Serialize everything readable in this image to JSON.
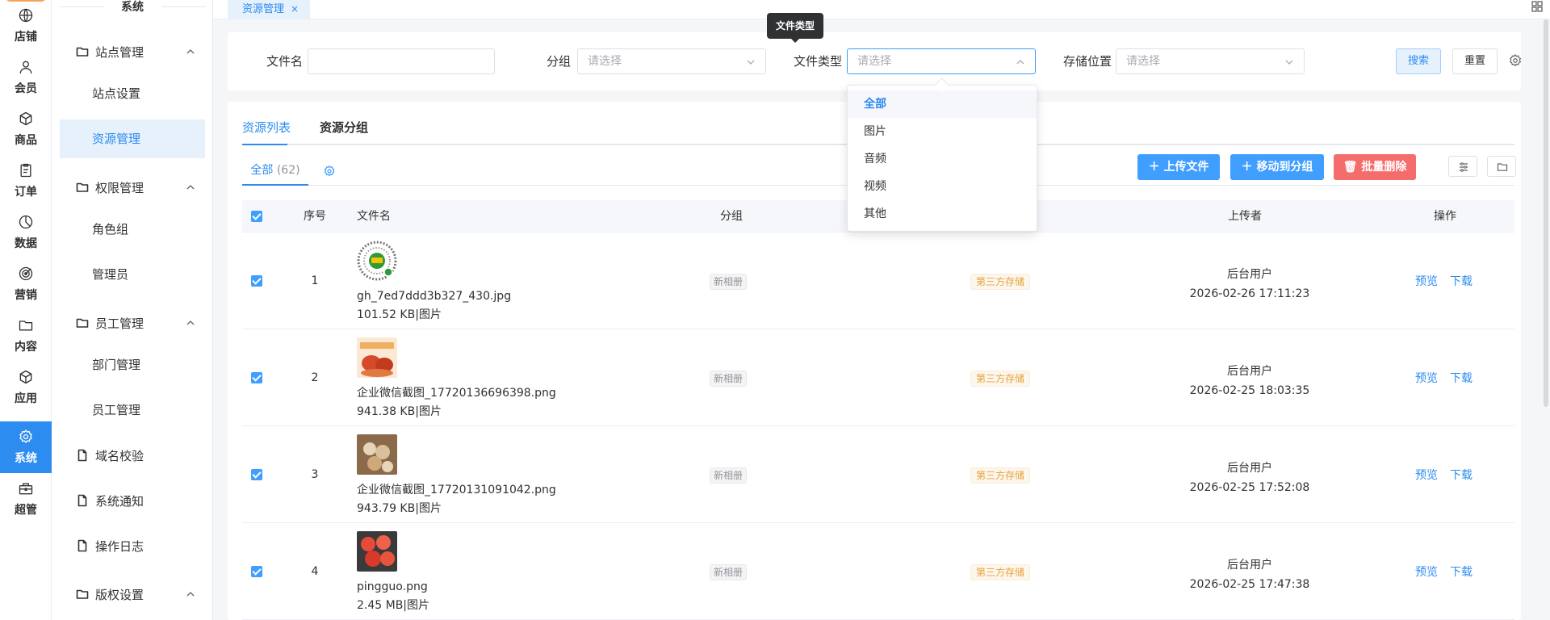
{
  "rail": {
    "items": [
      {
        "label": "店铺",
        "icon": "store-icon"
      },
      {
        "label": "会员",
        "icon": "member-icon"
      },
      {
        "label": "商品",
        "icon": "product-icon"
      },
      {
        "label": "订单",
        "icon": "order-icon"
      },
      {
        "label": "数据",
        "icon": "data-icon"
      },
      {
        "label": "营销",
        "icon": "marketing-icon"
      },
      {
        "label": "内容",
        "icon": "content-icon"
      },
      {
        "label": "应用",
        "icon": "app-icon"
      },
      {
        "label": "系统",
        "icon": "system-gear-icon",
        "active": true
      },
      {
        "label": "超管",
        "icon": "admin-icon"
      }
    ]
  },
  "menu": {
    "title": "系统",
    "groups": [
      {
        "label": "站点管理"
      },
      {
        "label": "权限管理"
      },
      {
        "label": "员工管理"
      },
      {
        "label": "域名校验"
      },
      {
        "label": "系统通知"
      },
      {
        "label": "操作日志"
      },
      {
        "label": "版权设置"
      }
    ],
    "subs": [
      {
        "label": "站点设置"
      },
      {
        "label": "资源管理",
        "active": true
      },
      {
        "label": "角色组"
      },
      {
        "label": "管理员"
      },
      {
        "label": "部门管理"
      },
      {
        "label": "员工管理"
      }
    ]
  },
  "tabbar": {
    "tab_label": "资源管理",
    "close": "×"
  },
  "filter": {
    "filename_label": "文件名",
    "filename_value": "",
    "group_label": "分组",
    "group_placeholder": "请选择",
    "filetype_label": "文件类型",
    "filetype_placeholder": "请选择",
    "storage_label": "存储位置",
    "storage_placeholder": "请选择",
    "search_btn": "搜索",
    "reset_btn": "重置"
  },
  "tooltip": "文件类型",
  "dropdown": {
    "options": [
      "全部",
      "图片",
      "音频",
      "视频",
      "其他"
    ],
    "selected": "全部"
  },
  "main": {
    "tabs": [
      "资源列表",
      "资源分组"
    ],
    "subtab_label": "全部",
    "subtab_count": "(62)",
    "upload_btn": "上传文件",
    "move_btn": "移动到分组",
    "delete_btn": "批量删除"
  },
  "table": {
    "headers": {
      "index": "序号",
      "filename": "文件名",
      "group": "分组",
      "uploader": "上传者",
      "action": "操作"
    },
    "rows": [
      {
        "index": "1",
        "name": "gh_7ed7ddd3b327_430.jpg",
        "meta": "101.52 KB|图片",
        "group": "新相册",
        "storage": "第三方存储",
        "uploader": "后台用户",
        "time": "2026-02-26 17:11:23",
        "preview": "预览",
        "download": "下载"
      },
      {
        "index": "2",
        "name": "企业微信截图_17720136696398.png",
        "meta": "941.38 KB|图片",
        "group": "新相册",
        "storage": "第三方存储",
        "uploader": "后台用户",
        "time": "2026-02-25 18:03:35",
        "preview": "预览",
        "download": "下载"
      },
      {
        "index": "3",
        "name": "企业微信截图_17720131091042.png",
        "meta": "943.79 KB|图片",
        "group": "新相册",
        "storage": "第三方存储",
        "uploader": "后台用户",
        "time": "2026-02-25 17:52:08",
        "preview": "预览",
        "download": "下载"
      },
      {
        "index": "4",
        "name": "pingguo.png",
        "meta": "2.45 MB|图片",
        "group": "新相册",
        "storage": "第三方存储",
        "uploader": "后台用户",
        "time": "2026-02-25 17:47:38",
        "preview": "预览",
        "download": "下载"
      }
    ]
  },
  "colors": {
    "primary": "#2d8cf0",
    "danger": "#f56c6c",
    "warning": "#e6a23c"
  }
}
